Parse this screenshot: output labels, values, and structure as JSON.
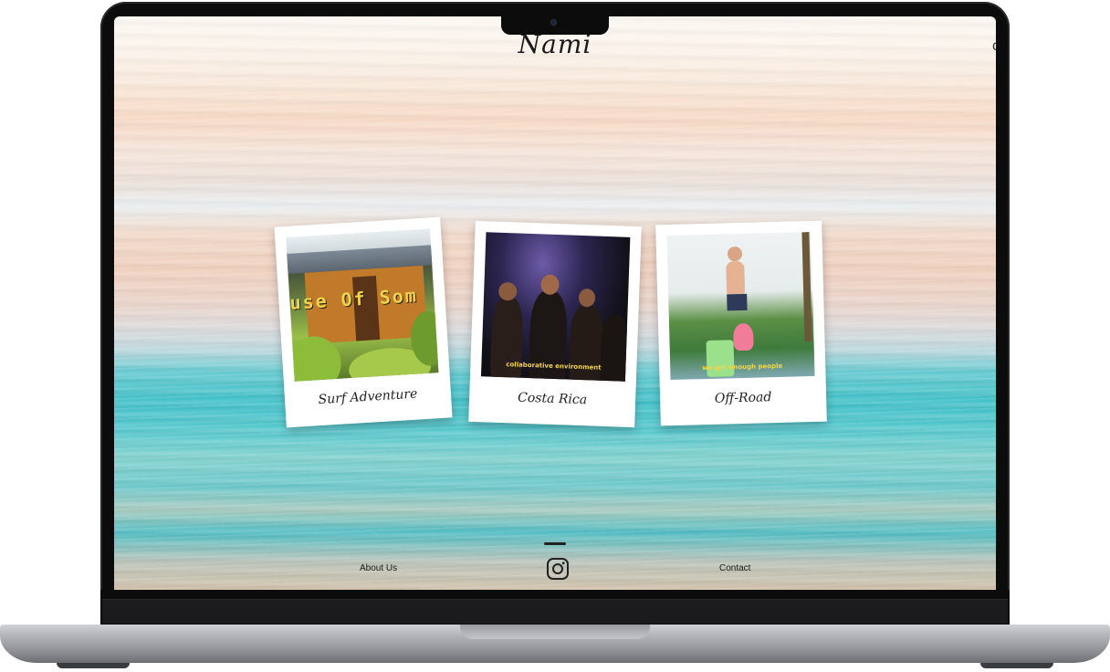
{
  "site": {
    "title": "Nami",
    "edge_glyph": "c"
  },
  "gallery": [
    {
      "caption": "Surf Adventure",
      "overlay_text": "use Of Som"
    },
    {
      "caption": "Costa Rica",
      "subtitle": "collaborative environment"
    },
    {
      "caption": "Off-Road",
      "subtitle": "we got enough people"
    }
  ],
  "footer": {
    "about_label": "About Us",
    "contact_label": "Contact",
    "social_icon": "instagram-icon"
  },
  "colors": {
    "caption": "#222222",
    "subtitle": "#f2d44a",
    "frame": "#0c0c0d"
  }
}
